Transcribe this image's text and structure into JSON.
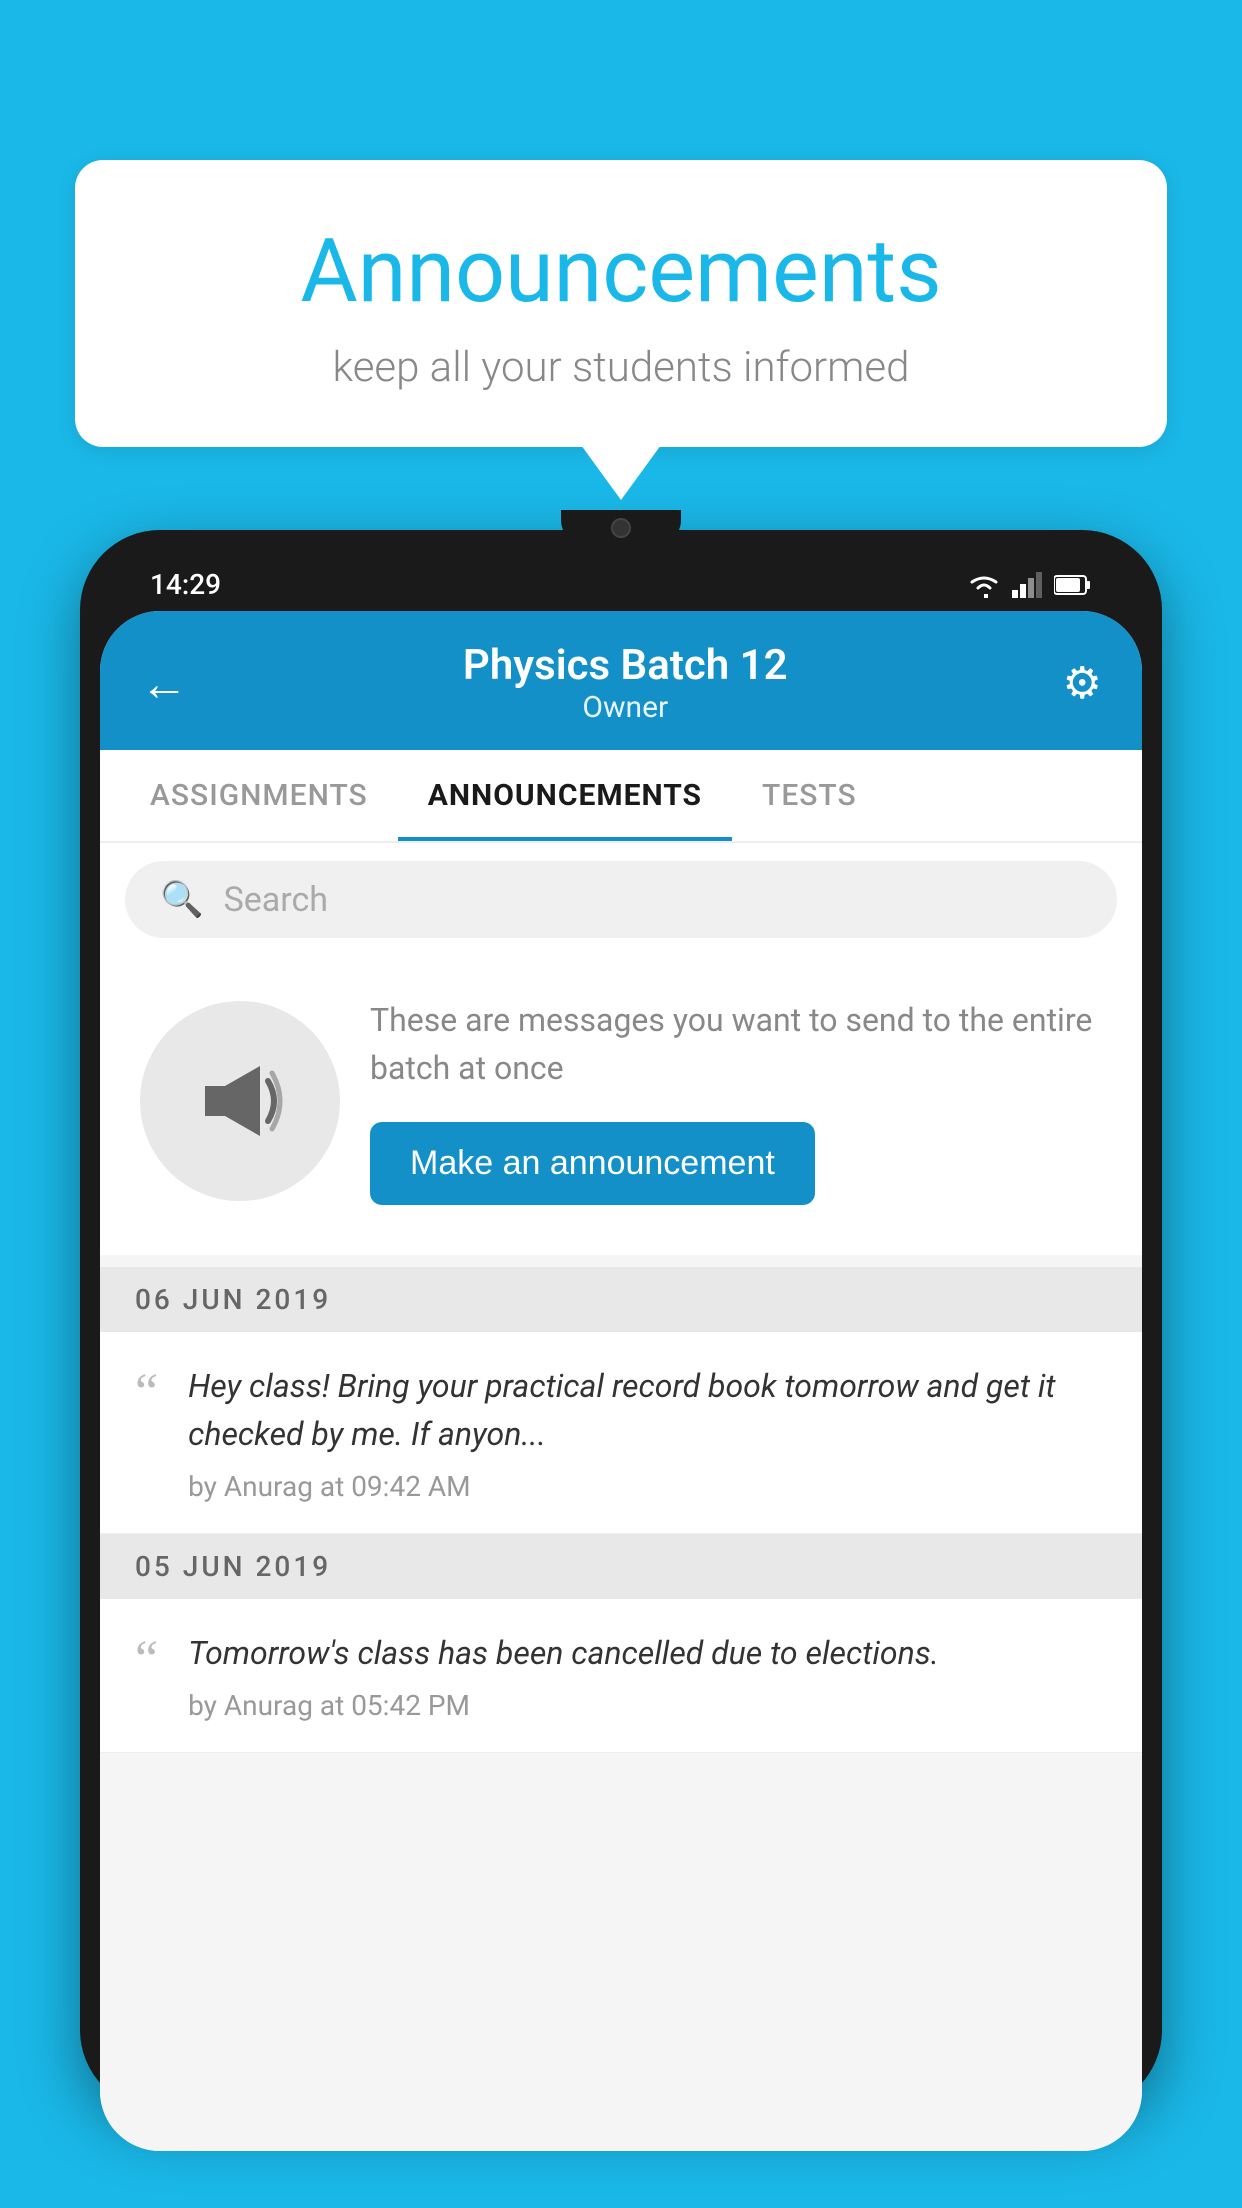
{
  "background": {
    "color": "#1ab8e8"
  },
  "speech_bubble": {
    "title": "Announcements",
    "subtitle": "keep all your students informed"
  },
  "phone": {
    "status_bar": {
      "time": "14:29"
    },
    "app_bar": {
      "title": "Physics Batch 12",
      "subtitle": "Owner",
      "back_icon": "←",
      "settings_icon": "⚙"
    },
    "tabs": [
      {
        "label": "ASSIGNMENTS",
        "active": false
      },
      {
        "label": "ANNOUNCEMENTS",
        "active": true
      },
      {
        "label": "TESTS",
        "active": false
      }
    ],
    "search": {
      "placeholder": "Search"
    },
    "promo": {
      "description": "These are messages you want to send to the entire batch at once",
      "button_label": "Make an announcement"
    },
    "announcements": [
      {
        "date": "06  JUN  2019",
        "text": "Hey class! Bring your practical record book tomorrow and get it checked by me. If anyon...",
        "meta": "by Anurag at 09:42 AM"
      },
      {
        "date": "05  JUN  2019",
        "text": "Tomorrow's class has been cancelled due to elections.",
        "meta": "by Anurag at 05:42 PM"
      }
    ]
  }
}
